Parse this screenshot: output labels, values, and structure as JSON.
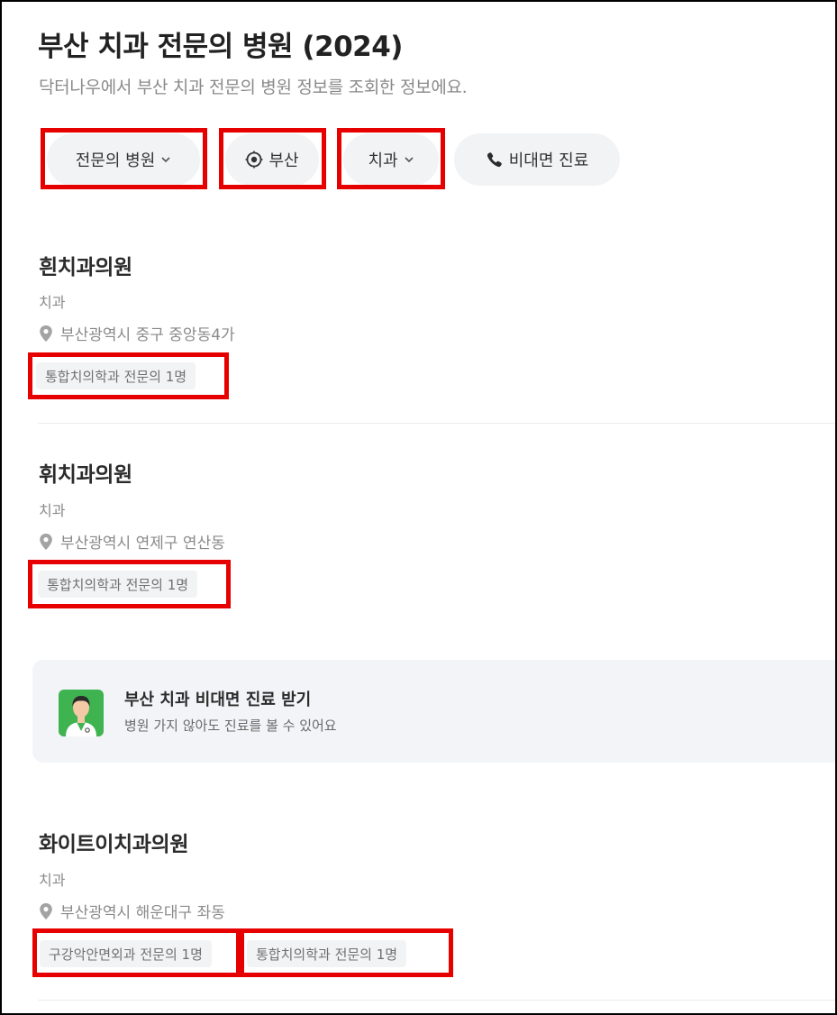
{
  "page": {
    "title": "부산 치과 전문의 병원 (2024)",
    "subtitle": "닥터나우에서 부산 치과 전문의 병원 정보를 조회한 정보에요."
  },
  "filters": {
    "specialist": {
      "label": "전문의 병원",
      "icon": "chevron-down-icon"
    },
    "location": {
      "label": "부산",
      "icon": "location-target-icon"
    },
    "department": {
      "label": "치과",
      "icon": "chevron-down-icon"
    },
    "telemedicine": {
      "label": "비대면 진료",
      "icon": "phone-icon"
    }
  },
  "hospitals": [
    {
      "name": "흰치과의원",
      "department": "치과",
      "address": "부산광역시 중구 중앙동4가",
      "tags": [
        "통합치의학과 전문의 1명"
      ]
    },
    {
      "name": "휘치과의원",
      "department": "치과",
      "address": "부산광역시 연제구 연산동",
      "tags": [
        "통합치의학과 전문의 1명"
      ]
    },
    {
      "name": "화이트이치과의원",
      "department": "치과",
      "address": "부산광역시 해운대구 좌동",
      "tags": [
        "구강악안면외과 전문의 1명",
        "통합치의학과 전문의 1명"
      ]
    }
  ],
  "banner": {
    "title": "부산 치과 비대면 진료 받기",
    "subtitle": "병원 가지 않아도 진료를 볼 수 있어요",
    "icon": "doctor-avatar-icon"
  },
  "colors": {
    "highlight": "#e60000",
    "chip_bg": "#f2f3f5",
    "banner_bg": "#f2f4f7",
    "avatar_bg": "#3fb34f"
  }
}
